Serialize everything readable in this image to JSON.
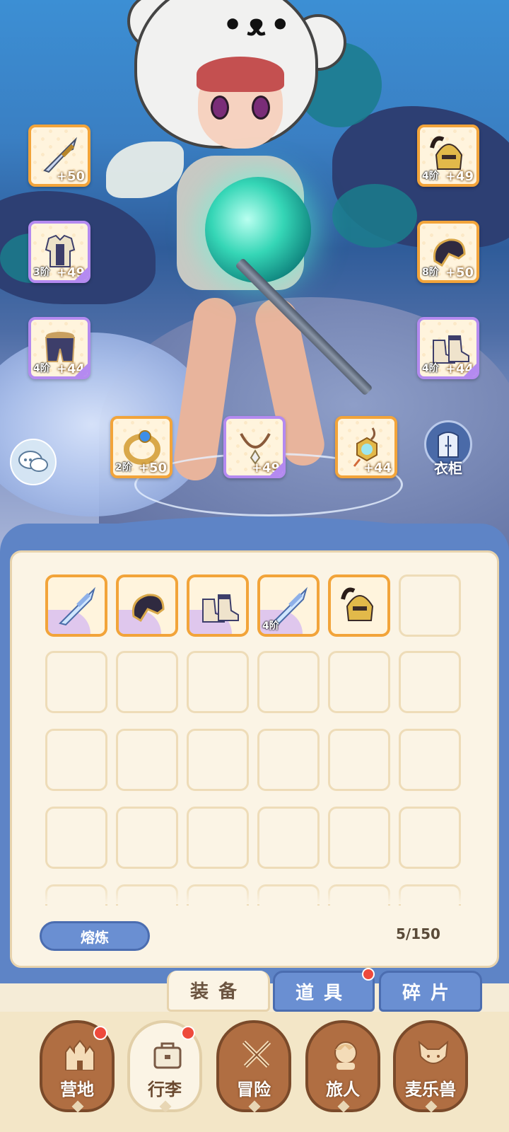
{
  "equip_slots": {
    "weapon": {
      "icon": "sword-icon",
      "tier": "",
      "plus": "+50"
    },
    "armor": {
      "icon": "armor-icon",
      "tier": "3阶",
      "plus": "+49"
    },
    "pants": {
      "icon": "pants-icon",
      "tier": "4阶",
      "plus": "+44"
    },
    "ring": {
      "icon": "ring-icon",
      "tier": "2阶",
      "plus": "+50"
    },
    "necklace": {
      "icon": "necklace-icon",
      "tier": "",
      "plus": "+49"
    },
    "amulet": {
      "icon": "amulet-icon",
      "tier": "",
      "plus": "+44"
    },
    "helmet": {
      "icon": "helmet-icon",
      "tier": "4阶",
      "plus": "+49"
    },
    "gloves": {
      "icon": "gloves-icon",
      "tier": "8阶",
      "plus": "+50"
    },
    "boots": {
      "icon": "boots-icon",
      "tier": "4阶",
      "plus": "+44"
    }
  },
  "wardrobe": {
    "label": "衣柜"
  },
  "inventory": {
    "items": [
      {
        "icon": "sword-icon",
        "tier": ""
      },
      {
        "icon": "gloves-icon",
        "tier": ""
      },
      {
        "icon": "boots-icon",
        "tier": ""
      },
      {
        "icon": "sword-icon",
        "tier": "4阶"
      },
      {
        "icon": "helmet-icon",
        "tier": ""
      }
    ],
    "smelt_label": "熔炼",
    "capacity": "5/150"
  },
  "tabs": [
    {
      "label": "装备",
      "active": true,
      "badge": false
    },
    {
      "label": "道具",
      "active": false,
      "badge": true
    },
    {
      "label": "碎片",
      "active": false,
      "badge": false
    }
  ],
  "nav": [
    {
      "label": "营地",
      "icon": "castle-icon",
      "badge": true
    },
    {
      "label": "行李",
      "icon": "bag-icon",
      "badge": true,
      "active": true
    },
    {
      "label": "冒险",
      "icon": "crossed-swords-icon",
      "badge": false
    },
    {
      "label": "旅人",
      "icon": "traveler-icon",
      "badge": false
    },
    {
      "label": "麦乐兽",
      "icon": "fox-icon",
      "badge": false
    }
  ],
  "colors": {
    "accent_orange": "#f2a43a",
    "panel_blue": "#5e84c6",
    "badge_red": "#ee4a3c"
  }
}
